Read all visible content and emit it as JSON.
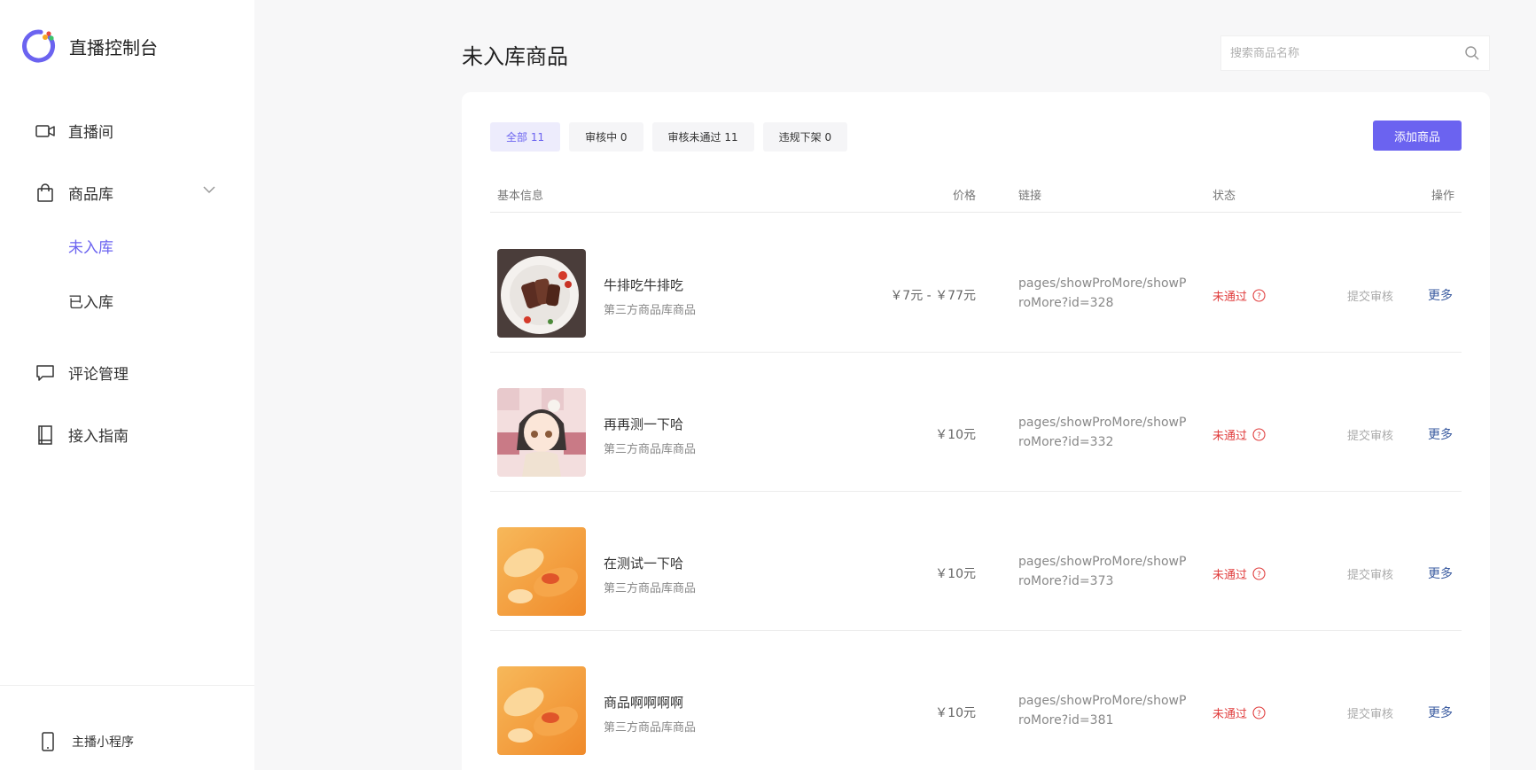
{
  "brand": {
    "title": "直播控制台"
  },
  "sidebar": {
    "items": [
      {
        "label": "直播间",
        "icon": "video-camera-icon"
      },
      {
        "label": "商品库",
        "icon": "shopping-bag-icon"
      },
      {
        "label": "未入库"
      },
      {
        "label": "已入库"
      },
      {
        "label": "评论管理",
        "icon": "comment-icon"
      },
      {
        "label": "接入指南",
        "icon": "book-icon"
      }
    ],
    "footer": {
      "label": "主播小程序",
      "icon": "phone-icon"
    }
  },
  "header": {
    "title": "未入库商品",
    "search": {
      "placeholder": "搜索商品名称",
      "value": ""
    }
  },
  "tabs": [
    {
      "label": "全部 11",
      "active": true
    },
    {
      "label": "审核中 0"
    },
    {
      "label": "审核未通过 11"
    },
    {
      "label": "违规下架 0"
    }
  ],
  "add_button": {
    "label": "添加商品"
  },
  "columns": {
    "basic": "基本信息",
    "price": "价格",
    "link": "链接",
    "status": "状态",
    "action": "操作"
  },
  "rows": [
    {
      "name": "牛排吃牛排吃",
      "source": "第三方商品库商品",
      "price": "￥7元 - ￥77元",
      "link": "pages/showProMore/showProMore?id=328",
      "status": "未通过",
      "submit": "提交审核",
      "more": "更多"
    },
    {
      "name": "再再测一下哈",
      "source": "第三方商品库商品",
      "price": "￥10元",
      "link": "pages/showProMore/showProMore?id=332",
      "status": "未通过",
      "submit": "提交审核",
      "more": "更多"
    },
    {
      "name": "在测试一下哈",
      "source": "第三方商品库商品",
      "price": "￥10元",
      "link": "pages/showProMore/showProMore?id=373",
      "status": "未通过",
      "submit": "提交审核",
      "more": "更多"
    },
    {
      "name": "商品啊啊啊啊",
      "source": "第三方商品库商品",
      "price": "￥10元",
      "link": "pages/showProMore/showProMore?id=381",
      "status": "未通过",
      "submit": "提交审核",
      "more": "更多"
    }
  ],
  "colors": {
    "accent": "#6b63f0",
    "error": "#e03c3c",
    "link": "#3a5ba0"
  }
}
